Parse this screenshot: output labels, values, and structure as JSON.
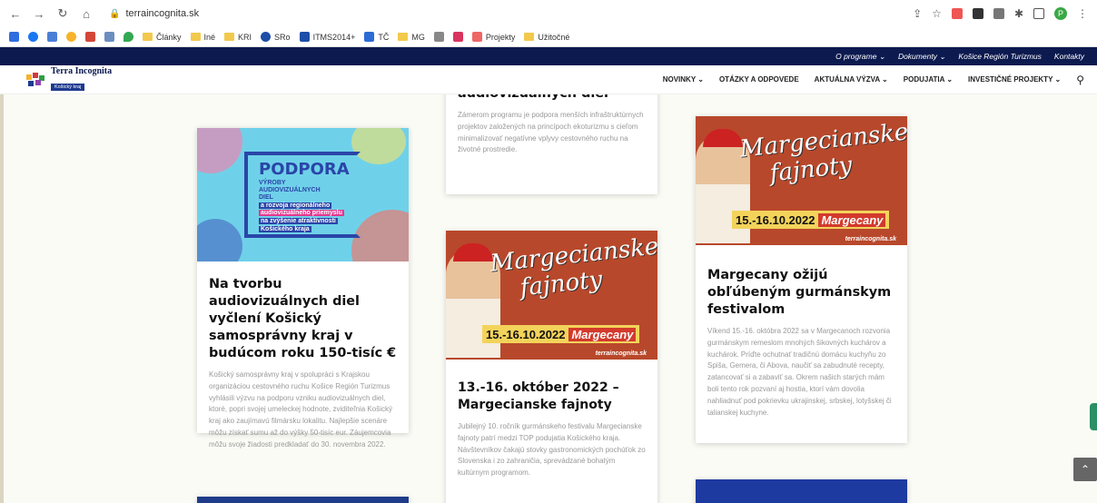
{
  "browser": {
    "url": "terraincognita.sk",
    "bookmarks": [
      "Články",
      "Iné",
      "KRI",
      "SRo",
      "ITMS2014+",
      "TČ",
      "MG",
      "Projekty",
      "Užitočné"
    ],
    "profile_initial": "P"
  },
  "topbar": {
    "links": [
      "O programe",
      "Dokumenty",
      "Košice Región Turizmus",
      "Kontakty"
    ]
  },
  "site": {
    "logo_title": "Terra Incognita",
    "logo_subtitle": "Košický kraj",
    "menu": [
      "NOVINKY",
      "OTÁZKY A ODPOVEDE",
      "AKTUÁLNA VÝZVA",
      "PODUJATIA",
      "INVESTIČNÉ PROJEKTY"
    ]
  },
  "cards": {
    "c1": {
      "title": "Na tvorbu audiovizuálnych diel vyčlení Košický samosprávny kraj v budúcom roku 150-tisíc €",
      "text": "Košický samosprávny kraj v spolupráci s Krajskou organizáciou cestovného ruchu Košice Región Turizmus vyhlásili výzvu na podporu vzniku audiovizuálnych diel, ktoré, popri svojej umeleckej hodnote, zviditeľnia Košický kraj ako zaujímavú filmársku lokalitu. Najlepšie scenáre môžu získať sumu až do výšky 50-tisíc eur. Záujemcovia môžu svoje žiadosti predkladať do 30. novembra 2022.",
      "img": {
        "title": "PODPORA",
        "lines": [
          "VÝROBY",
          "AUDIOVIZUÁLNYCH",
          "DIEL",
          "a rozvoja regionálneho",
          "audiovizuálneho priemyslu",
          "na zvýšenie atraktívnosti",
          "Košického kraja"
        ]
      }
    },
    "c2top": {
      "title": "audiovizuálnych diel",
      "text": "Zámerom programu je podpora menších infraštruktúrnych projektov založených na princípoch ekoturizmu s cieľom minimalizovať negatívne vplyvy cestovného ruchu na životné prostredie."
    },
    "c2": {
      "title": "13.-16. október 2022 – Margecianske fajnoty",
      "text": "Jubilejný 10. ročník gurmánskeho festivalu Margecianske fajnoty patrí medzi TOP podujatia Košického kraja. Návštevníkov čakajú stovky gastronomických pochúťok zo Slovenska i zo zahraničia, sprevádzané bohatým kultúrnym programom."
    },
    "c3": {
      "title": "Margecany ožijú obľúbeným gurmánskym festivalom",
      "text": "Víkend 15.-16. októbra 2022 sa v Margecanoch rozvonia gurmánskym remeslom mnohých šikovných kuchárov a kuchárok. Príďte ochutnať tradičnú domácu kuchyňu zo Spiša, Gemera, či Abova, naučiť sa zabudnuté recepty, zatancovať si a zabaviť sa. Okrem našich starých mám boli tento rok pozvaní aj hostia, ktorí vám dovolia nahliadnuť pod pokrievku ukrajinskej, srbskej, lotyšskej či talianskej kuchyne."
    },
    "fest_img": {
      "title_line1": "Margecianske",
      "title_line2": "fajnoty",
      "dates": "15.-16.10.2022",
      "location": "Margecany",
      "site": "terraincognita.sk"
    }
  }
}
